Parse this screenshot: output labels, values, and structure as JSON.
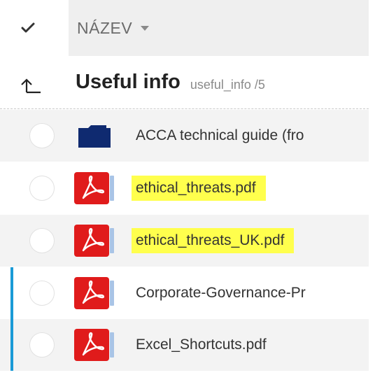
{
  "header": {
    "column_name_label": "NÁZEV",
    "select_all_icon": "checkmark-icon",
    "sort_icon": "caret-down-icon"
  },
  "folder": {
    "title": "Useful info",
    "subtitle": "useful_info /5",
    "up_icon": "up-arrow-icon"
  },
  "files": [
    {
      "name": "ACCA technical guide (fro",
      "type": "folder",
      "icon": "folder-icon",
      "highlighted": false,
      "alt_bg": true,
      "left_bar": false
    },
    {
      "name": "ethical_threats.pdf",
      "type": "pdf",
      "icon": "pdf-icon",
      "highlighted": true,
      "alt_bg": false,
      "left_bar": false
    },
    {
      "name": "ethical_threats_UK.pdf",
      "type": "pdf",
      "icon": "pdf-icon",
      "highlighted": true,
      "alt_bg": true,
      "left_bar": false
    },
    {
      "name": "Corporate-Governance-Pr",
      "type": "pdf",
      "icon": "pdf-icon",
      "highlighted": false,
      "alt_bg": false,
      "left_bar": true
    },
    {
      "name": "Excel_Shortcuts.pdf",
      "type": "pdf",
      "icon": "pdf-icon",
      "highlighted": false,
      "alt_bg": true,
      "left_bar": true
    }
  ],
  "colors": {
    "header_bg": "#efefef",
    "highlight": "#ffff4d",
    "pdf_red": "#e01b1b",
    "folder_navy": "#0f2a70",
    "accent_bar": "#1a9ad6"
  }
}
